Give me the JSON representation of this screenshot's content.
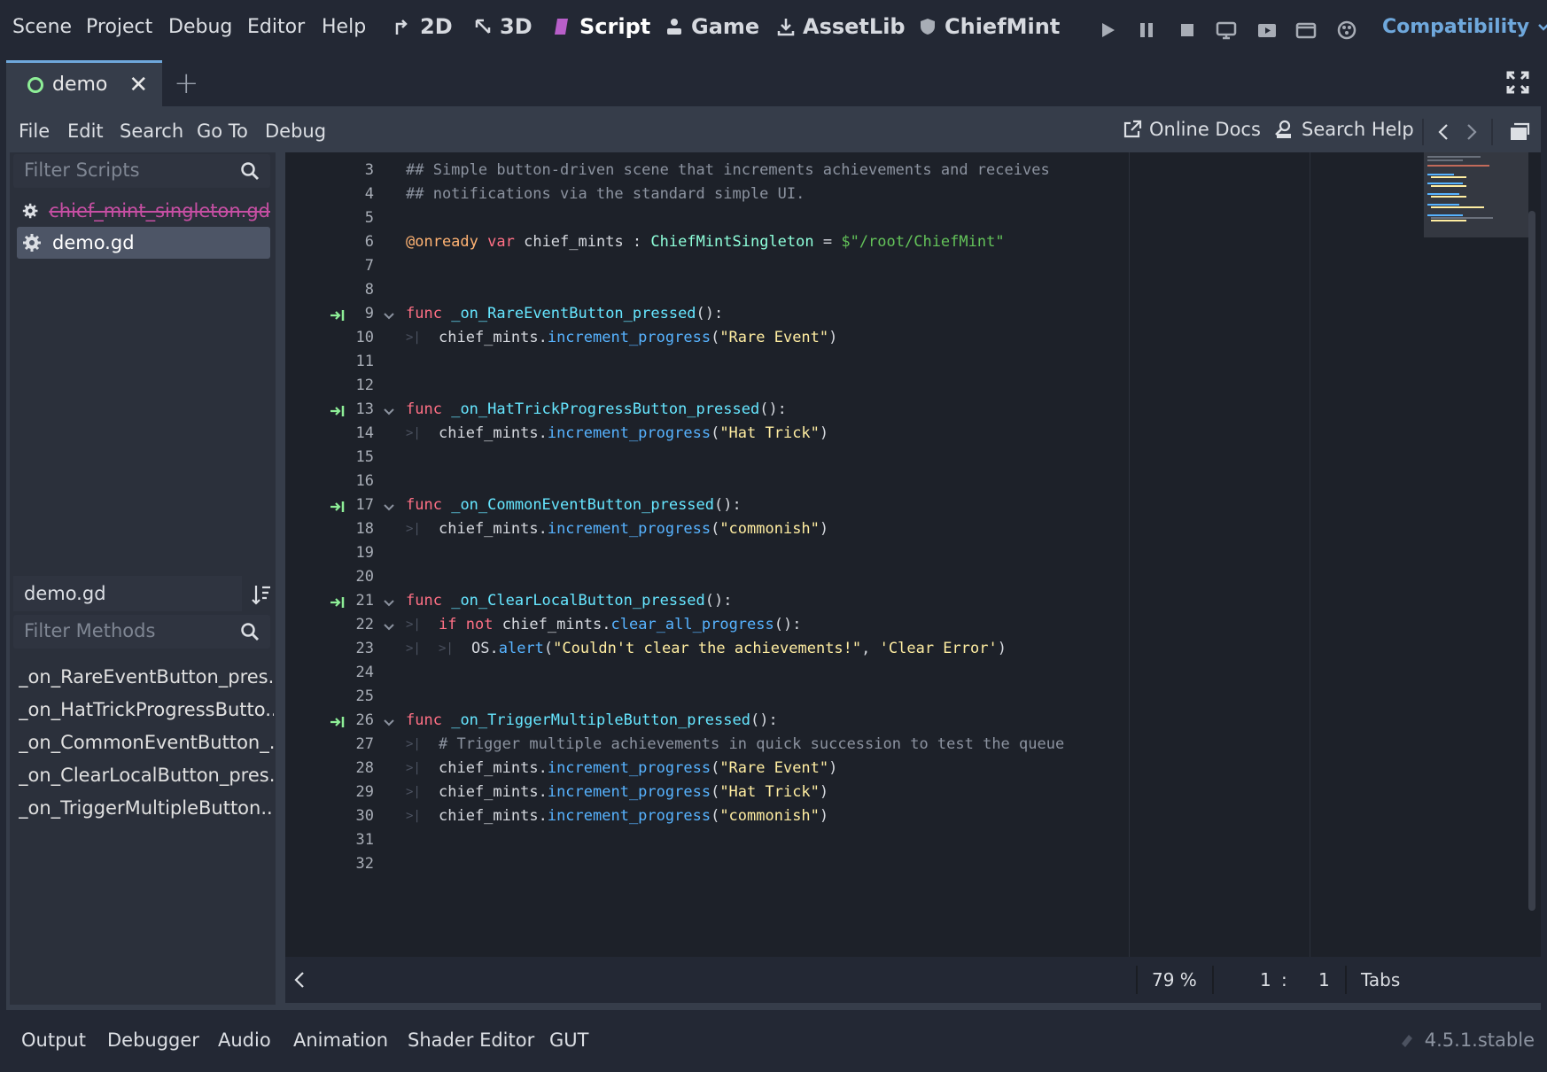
{
  "menu": [
    "Scene",
    "Project",
    "Debug",
    "Editor",
    "Help"
  ],
  "workspaces": [
    "2D",
    "3D",
    "Script",
    "Game",
    "AssetLib",
    "ChiefMint"
  ],
  "renderer": "Compatibility",
  "scene_tab": "demo",
  "script_menu": [
    "File",
    "Edit",
    "Search",
    "Go To",
    "Debug"
  ],
  "online_docs": "Online Docs",
  "search_help": "Search Help",
  "filter_scripts_placeholder": "Filter Scripts",
  "scripts": [
    "chief_mint_singleton.gd",
    "demo.gd"
  ],
  "current_script": "demo.gd",
  "filter_methods_placeholder": "Filter Methods",
  "methods": [
    "_on_RareEventButton_pres...",
    "_on_HatTrickProgressButto...",
    "_on_CommonEventButton_...",
    "_on_ClearLocalButton_pres...",
    "_on_TriggerMultipleButton..."
  ],
  "line_numbers": [
    "3",
    "4",
    "5",
    "6",
    "7",
    "8",
    "9",
    "10",
    "11",
    "12",
    "13",
    "14",
    "15",
    "16",
    "17",
    "18",
    "19",
    "20",
    "21",
    "22",
    "23",
    "24",
    "25",
    "26",
    "27",
    "28",
    "29",
    "30",
    "31",
    "32"
  ],
  "code": {
    "l3": "## Simple button-driven scene that increments achievements and receives",
    "l4": "## notifications via the standard simple UI.",
    "l6a": "@onready",
    "l6b": "var",
    "l6c": " chief_mints : ",
    "l6d": "ChiefMintSingleton",
    "l6e": " = ",
    "l6f": "$\"/root/ChiefMint\"",
    "func": "func",
    "f9": "_on_RareEventButton_pressed",
    "f13": "_on_HatTrickProgressButton_pressed",
    "f17": "_on_CommonEventButton_pressed",
    "f21": "_on_ClearLocalButton_pressed",
    "f26": "_on_TriggerMultipleButton_pressed",
    "paren": "():",
    "obj": "chief_mints.",
    "inc": "increment_progress",
    "s_rare": "\"Rare Event\"",
    "s_hat": "\"Hat Trick\"",
    "s_common": "\"commonish\"",
    "l22a": "if",
    "l22b": "not",
    "l22c": " chief_mints.",
    "l22d": "clear_all_progress",
    "l22e": "():",
    "l23a": "OS.",
    "l23b": "alert",
    "l23c": "\"Couldn't clear the achievements!\"",
    "l23d": "'Clear Error'",
    "l27": "# Trigger multiple achievements in quick succession to test the queue",
    "open": "(",
    "close": ")",
    "comma": ", "
  },
  "status": {
    "zoom": "79 %",
    "line": "1",
    "sep": ":",
    "col": "1",
    "indent": "Tabs"
  },
  "bottom_tabs": [
    "Output",
    "Debugger",
    "Audio",
    "Animation",
    "Shader Editor",
    "GUT"
  ],
  "version": "4.5.1.stable"
}
